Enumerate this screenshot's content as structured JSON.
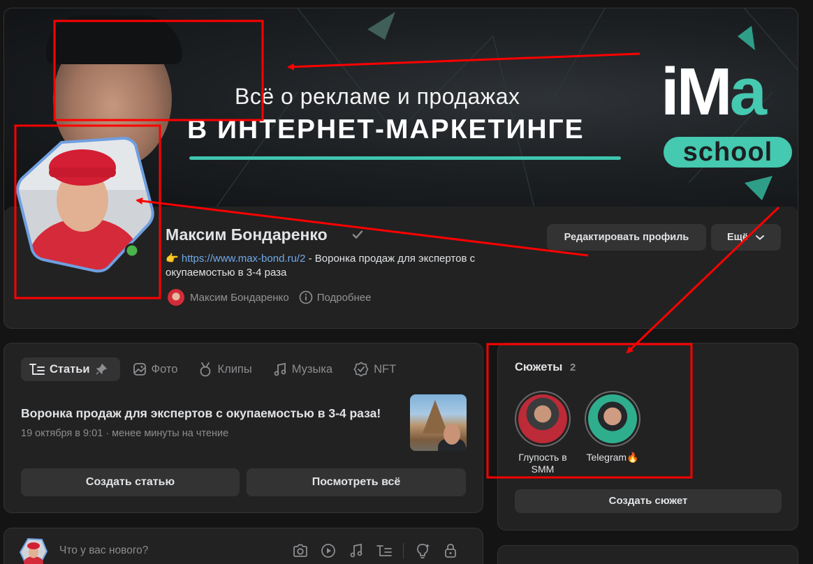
{
  "cover": {
    "title_line_1": "Всё о рекламе и продажах",
    "title_line_2": "В ИНТЕРНЕТ-МАРКЕТИНГЕ",
    "logo_main_prefix": "iM",
    "logo_main_accent": "a",
    "logo_sub": "school",
    "accent_color": "#45c9b0"
  },
  "profile": {
    "name": "Максим Бондаренко",
    "verified_icon": "checkmark-icon",
    "status_emoji": "👉",
    "status_link": "https://www.max-bond.ru/2",
    "status_text": " - Воронка продаж для экспертов с окупаемостью в 3-4 раза",
    "meta_name": "Максим Бондаренко",
    "meta_more": "Подробнее",
    "online_color": "#4bb34b",
    "edit_button": "Редактировать профиль",
    "more_button": "Ещё"
  },
  "articles": {
    "tabs": [
      {
        "label": "Статьи",
        "icon": "article-icon"
      },
      {
        "label": "Фото",
        "icon": "photo-icon"
      },
      {
        "label": "Клипы",
        "icon": "clips-icon"
      },
      {
        "label": "Музыка",
        "icon": "music-icon"
      },
      {
        "label": "NFT",
        "icon": "nft-icon"
      }
    ],
    "active_tab": "Статьи",
    "title": "Воронка продаж для экспертов с окупаемостью в 3-4 раза!",
    "meta": "19 октября в 9:01 · менее минуты на чтение",
    "create_button": "Создать статью",
    "view_all_button": "Посмотреть всё"
  },
  "stories": {
    "title": "Сюжеты",
    "count": "2",
    "items": [
      {
        "label": "Глупость в SMM"
      },
      {
        "label": "Telegram🔥"
      }
    ],
    "create_button": "Создать сюжет"
  },
  "composer": {
    "placeholder": "Что у вас нового?",
    "icons": [
      "camera-icon",
      "video-icon",
      "music-icon",
      "article-icon",
      "idea-icon",
      "lock-icon"
    ]
  },
  "annotation_color": "#ff0000"
}
